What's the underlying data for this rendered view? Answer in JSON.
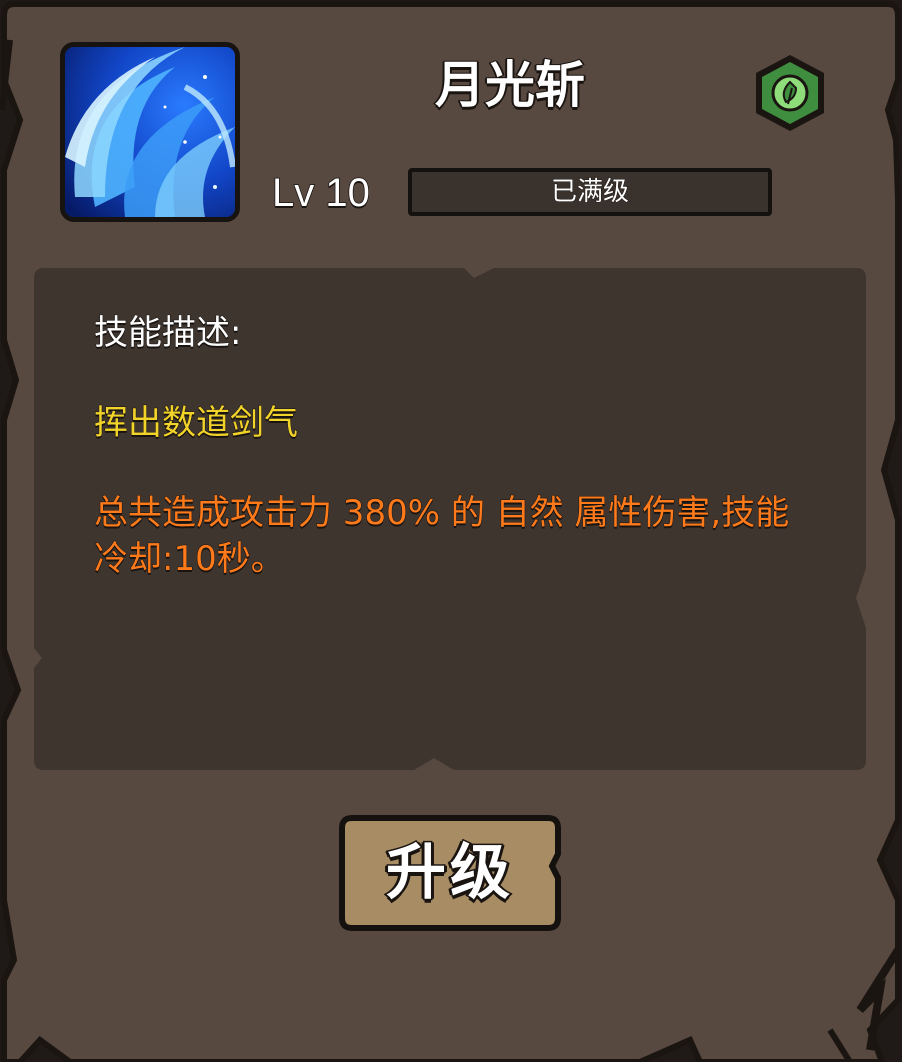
{
  "skill": {
    "name": "月光斩",
    "icon": "crescent-slash-icon",
    "element": "nature",
    "element_icon": "leaf-icon",
    "level_label": "Lv 10",
    "status_text": "已满级",
    "level_progress": 1.0
  },
  "description": {
    "heading": "技能描述:",
    "summary": "挥出数道剑气",
    "detail": "总共造成攻击力 380% 的 自然 属性伤害,技能冷却:10秒。"
  },
  "actions": {
    "upgrade_label": "升级"
  },
  "colors": {
    "panel": "#574840",
    "description_box": "#3e352f",
    "summary_text": "#f2d32a",
    "detail_text": "#ff7a1a",
    "button_fill": "#a88d64",
    "element_badge": "#3f8d3f"
  }
}
